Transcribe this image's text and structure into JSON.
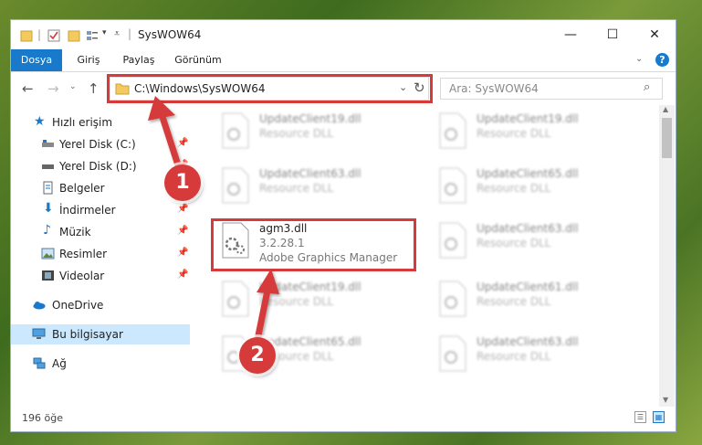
{
  "window": {
    "title": "SysWOW64",
    "controls": {
      "minimize": "—",
      "maximize": "☐",
      "close": "✕"
    }
  },
  "ribbon": {
    "tabs": [
      "Dosya",
      "Giriş",
      "Paylaş",
      "Görünüm"
    ],
    "help": "?"
  },
  "address": {
    "path": "C:\\Windows\\SysWOW64",
    "search_placeholder": "Ara: SysWOW64"
  },
  "sidebar": {
    "items": [
      {
        "label": "Hızlı erişim",
        "icon": "star-icon",
        "pinned": false
      },
      {
        "label": "Yerel Disk (C:)",
        "icon": "drive-icon",
        "pinned": true
      },
      {
        "label": "Yerel Disk (D:)",
        "icon": "drive-icon",
        "pinned": true
      },
      {
        "label": "Belgeler",
        "icon": "document-icon",
        "pinned": true
      },
      {
        "label": "İndirmeler",
        "icon": "download-icon",
        "pinned": true
      },
      {
        "label": "Müzik",
        "icon": "music-icon",
        "pinned": true
      },
      {
        "label": "Resimler",
        "icon": "pictures-icon",
        "pinned": true
      },
      {
        "label": "Videolar",
        "icon": "video-icon",
        "pinned": true
      },
      {
        "label": "OneDrive",
        "icon": "cloud-icon",
        "pinned": false
      },
      {
        "label": "Bu bilgisayar",
        "icon": "computer-icon",
        "pinned": false
      },
      {
        "label": "Ağ",
        "icon": "network-icon",
        "pinned": false
      }
    ]
  },
  "files": [
    {
      "name": "UpdateClient19.dll",
      "line1": "Resource DLL",
      "line2": ""
    },
    {
      "name": "UpdateClient19.dll",
      "line1": "Resource DLL",
      "line2": ""
    },
    {
      "name": "UpdateClient63.dll",
      "line1": "Resource DLL",
      "line2": ""
    },
    {
      "name": "UpdateClient65.dll",
      "line1": "Resource DLL",
      "line2": ""
    },
    {
      "name": "agm3.dll",
      "line1": "3.2.28.1",
      "line2": "Adobe Graphics Manager"
    },
    {
      "name": "UpdateClient63.dll",
      "line1": "Resource DLL",
      "line2": ""
    },
    {
      "name": "UpdateClient19.dll",
      "line1": "Resource DLL",
      "line2": ""
    },
    {
      "name": "UpdateClient61.dll",
      "line1": "Resource DLL",
      "line2": ""
    },
    {
      "name": "UpdateClient65.dll",
      "line1": "Resource DLL",
      "line2": ""
    },
    {
      "name": "UpdateClient63.dll",
      "line1": "Resource DLL",
      "line2": ""
    }
  ],
  "status": {
    "item_count": "196 öğe"
  },
  "annotations": {
    "badge1": "1",
    "badge2": "2",
    "accent": "#d63a3a"
  }
}
